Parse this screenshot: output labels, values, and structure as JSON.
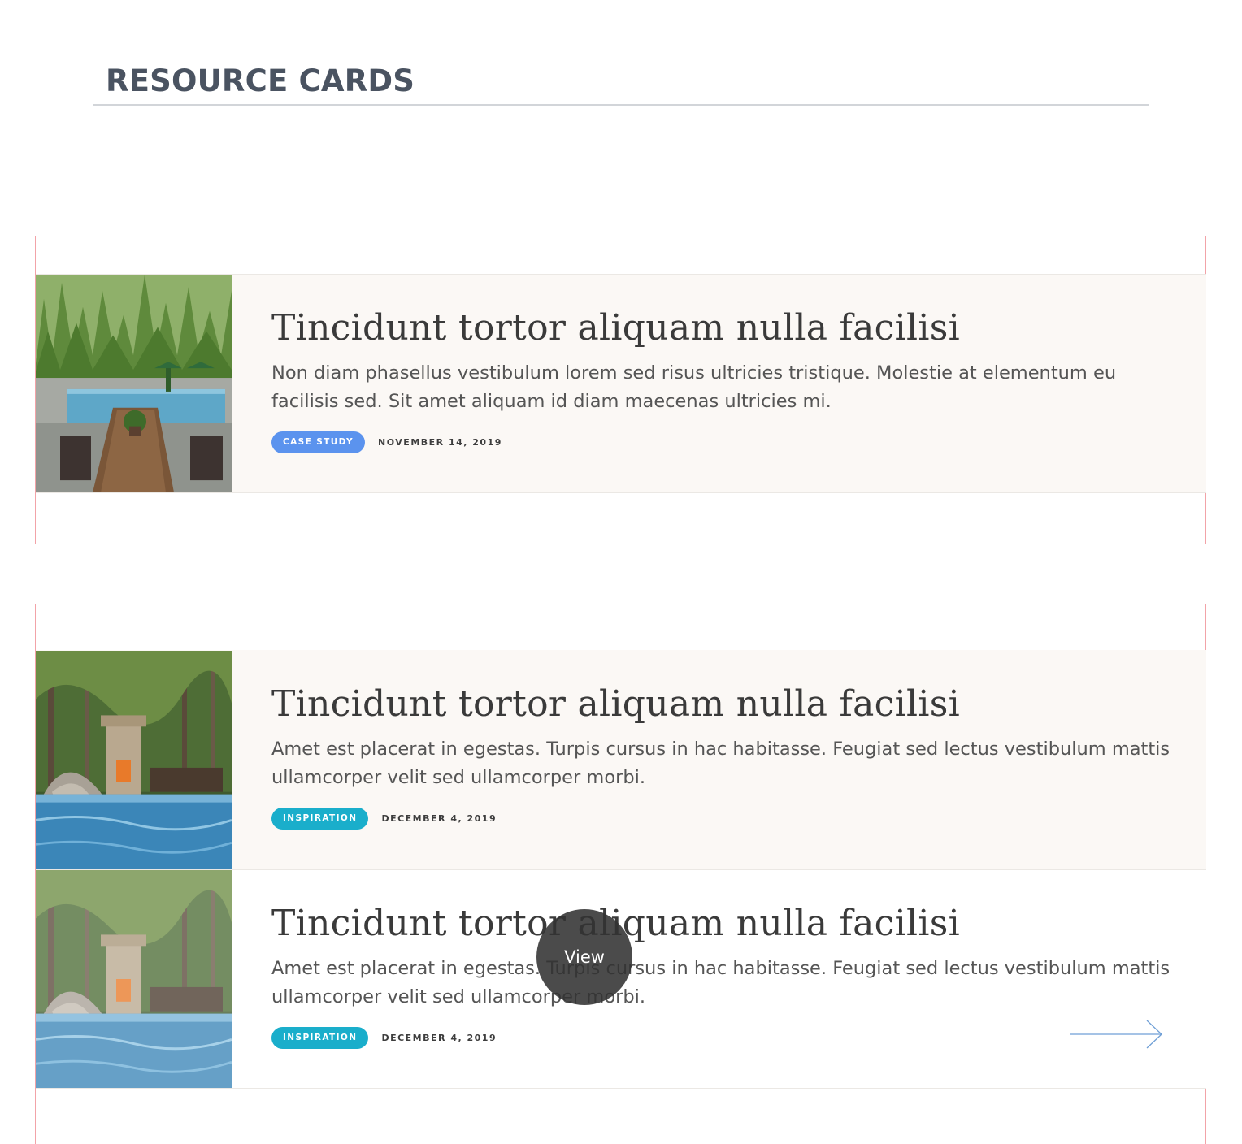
{
  "page": {
    "heading": "RESOURCE CARDS"
  },
  "colors": {
    "case_study": "#5b93ee",
    "inspiration": "#1aaecb",
    "guide": "#f2a3a8",
    "card_tint": "#fbf8f5"
  },
  "cards": [
    {
      "title": "Tincidunt tortor aliquam nulla facilisi",
      "description": "Non diam phasellus vestibulum lorem sed risus ultricies tristique. Molestie at elementum eu facilisis sed. Sit amet aliquam id diam maecenas ultricies mi.",
      "tag": "CASE STUDY",
      "date": "NOVEMBER 14, 2019",
      "image": "patio-pool-photo"
    },
    {
      "title": "Tincidunt tortor aliquam nulla facilisi",
      "description": "Amet est placerat in egestas. Turpis cursus in hac habitasse. Feugiat sed lectus vestibulum mattis ullamcorper velit sed ullamcorper morbi.",
      "tag": "INSPIRATION",
      "date": "DECEMBER 4, 2019",
      "image": "pool-fireplace-photo"
    },
    {
      "title": "Tincidunt tortor aliquam nulla facilisi",
      "description": "Amet est placerat in egestas. Turpis cursus in hac habitasse. Feugiat sed lectus vestibulum mattis ullamcorper velit sed ullamcorper morbi.",
      "tag": "INSPIRATION",
      "date": "DECEMBER 4, 2019",
      "image": "pool-fireplace-photo",
      "hover_label": "View",
      "arrow_icon": "arrow-right-icon"
    }
  ]
}
